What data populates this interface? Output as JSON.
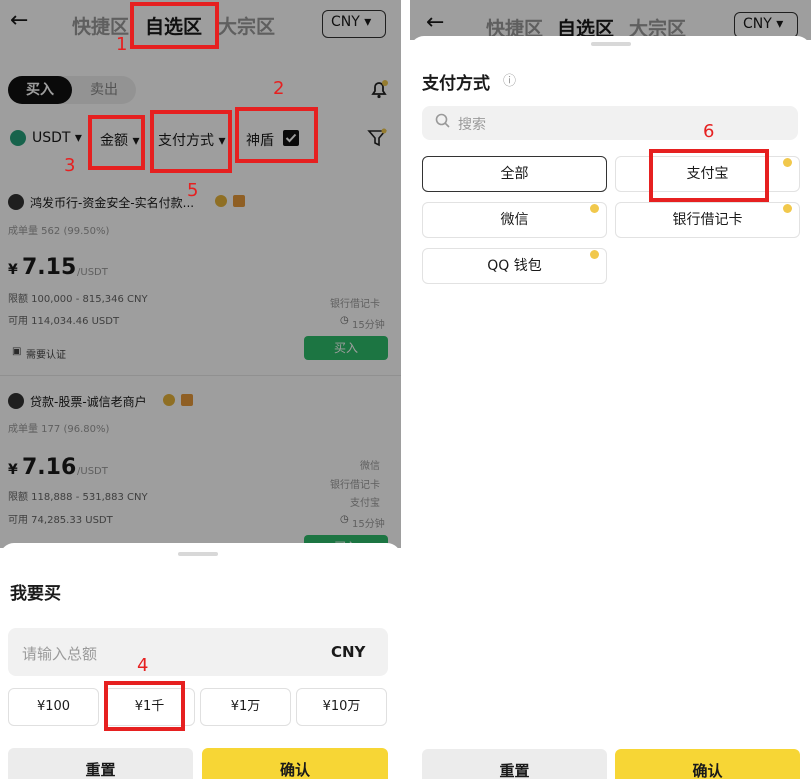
{
  "left": {
    "header": {
      "back_icon": "←",
      "tabs": [
        "快捷区",
        "自选区",
        "大宗区"
      ],
      "currency": "CNY ▾"
    },
    "trade_toggle": {
      "buy": "买入",
      "sell": "卖出"
    },
    "filters": {
      "coin": "USDT ▾",
      "amount": "金额 ▾",
      "payment": "支付方式 ▾",
      "shield": "神盾"
    },
    "listings": [
      {
        "merchant": "鸿发币行-资金安全-实名付款...",
        "stats": "成单量 562 (99.50%)",
        "currency_sign": "¥",
        "price": "7.15",
        "unit": "/USDT",
        "limit": "限额 100,000 - 815,346 CNY",
        "available": "可用 114,034.46 USDT",
        "methods": [
          "银行借记卡"
        ],
        "time": "15分钟",
        "verify": "需要认证",
        "buy": "买入"
      },
      {
        "merchant": "贷款-股票-诚信老商户",
        "stats": "成单量 177 (96.80%)",
        "currency_sign": "¥",
        "price": "7.16",
        "unit": "/USDT",
        "limit": "限额 118,888 - 531,883 CNY",
        "available": "可用 74,285.33 USDT",
        "methods": [
          "微信",
          "银行借记卡",
          "支付宝"
        ],
        "time": "15分钟",
        "buy": "买入"
      }
    ],
    "sheet": {
      "title": "我要买",
      "input_placeholder": "请输入总额",
      "input_currency": "CNY",
      "chips": [
        "¥100",
        "¥1千",
        "¥1万",
        "¥10万"
      ],
      "reset": "重置",
      "confirm": "确认"
    }
  },
  "right": {
    "header": {
      "back_icon": "←",
      "tabs": [
        "快捷区",
        "自选区",
        "大宗区"
      ],
      "currency": "CNY ▾"
    },
    "sheet": {
      "title": "支付方式",
      "info_icon": "ⓘ",
      "search_placeholder": "搜索",
      "options": [
        "全部",
        "支付宝",
        "微信",
        "银行借记卡",
        "QQ 钱包"
      ],
      "reset": "重置",
      "confirm": "确认"
    }
  },
  "annotations": [
    "1",
    "2",
    "3",
    "4",
    "5",
    "6"
  ],
  "colors": {
    "buy_green": "#2ebd6b",
    "confirm_yellow": "#f7d635",
    "annotation_red": "#e62020"
  }
}
